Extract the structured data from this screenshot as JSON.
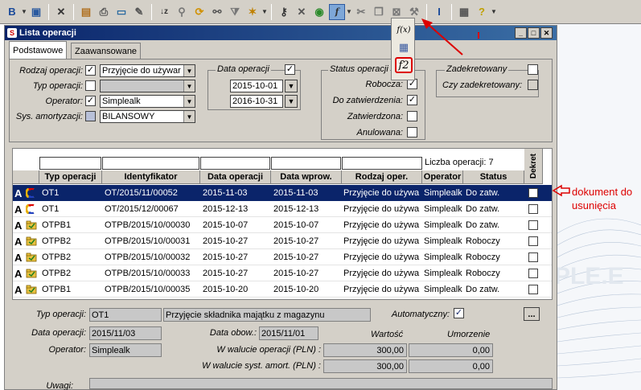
{
  "window": {
    "title": "Lista operacji",
    "tabs": [
      "Podstawowe",
      "Zaawansowane"
    ]
  },
  "toolbar": {
    "icons": [
      "bold-icon",
      "save-icon",
      "delete-icon",
      "document-icon",
      "print-icon",
      "export-icon",
      "edit-icon",
      "sort-icon",
      "pin-icon",
      "refresh-icon",
      "binoculars-icon",
      "filter-icon",
      "new-icon",
      "key-icon",
      "close-icon",
      "accept-icon",
      "function-icon",
      "cut-icon",
      "copy-icon",
      "cancel-icon",
      "tool-icon",
      "text-cursor-icon",
      "grid-icon",
      "help-icon"
    ]
  },
  "popup": {
    "items": [
      "f(x)",
      "grid",
      "f2"
    ]
  },
  "filters": {
    "rodzaj_label": "Rodzaj operacji:",
    "rodzaj_value": "Przyjęcie do używar",
    "typ_label": "Typ operacji:",
    "typ_value": "",
    "operator_label": "Operator:",
    "operator_value": "Simplealk",
    "sys_label": "Sys. amortyzacji:",
    "sys_value": "BILANSOWY",
    "data_group": "Data operacji",
    "date_from": "2015-10-01",
    "date_to": "2016-10-31",
    "status_group": "Status operacji",
    "robocza": "Robocza:",
    "do_zatwierdzenia": "Do zatwierdzenia:",
    "zatwierdzona": "Zatwierdzona:",
    "anulowana": "Anulowana:",
    "zadekretowany_group": "Zadekretowany",
    "czy_zadekretowany": "Czy zadekretowany:"
  },
  "grid": {
    "count_label": "Liczba operacji: 7",
    "columns": [
      "Typ operacji",
      "Identyfikator",
      "Data operacji",
      "Data wprow.",
      "Rodzaj oper.",
      "Operator",
      "Status",
      "Dekret"
    ],
    "rows": [
      {
        "typ": "OT1",
        "id": "OT/2015/11/00052",
        "data_op": "2015-11-03",
        "data_wpr": "2015-11-03",
        "rodzaj": "Przyjęcie do używa",
        "operator": "Simplealk",
        "status": "Do zatw."
      },
      {
        "typ": "OT1",
        "id": "OT/2015/12/00067",
        "data_op": "2015-12-13",
        "data_wpr": "2015-12-13",
        "rodzaj": "Przyjęcie do używa",
        "operator": "Simplealk",
        "status": "Do zatw."
      },
      {
        "typ": "OTPB1",
        "id": "OTPB/2015/10/00030",
        "data_op": "2015-10-07",
        "data_wpr": "2015-10-07",
        "rodzaj": "Przyjęcie do używa",
        "operator": "Simplealk",
        "status": "Do zatw."
      },
      {
        "typ": "OTPB2",
        "id": "OTPB/2015/10/00031",
        "data_op": "2015-10-27",
        "data_wpr": "2015-10-27",
        "rodzaj": "Przyjęcie do używa",
        "operator": "Simplealk",
        "status": "Roboczy"
      },
      {
        "typ": "OTPB2",
        "id": "OTPB/2015/10/00032",
        "data_op": "2015-10-27",
        "data_wpr": "2015-10-27",
        "rodzaj": "Przyjęcie do używa",
        "operator": "Simplealk",
        "status": "Roboczy"
      },
      {
        "typ": "OTPB2",
        "id": "OTPB/2015/10/00033",
        "data_op": "2015-10-27",
        "data_wpr": "2015-10-27",
        "rodzaj": "Przyjęcie do używa",
        "operator": "Simplealk",
        "status": "Roboczy"
      },
      {
        "typ": "OTPB1",
        "id": "OTPB/2015/10/00035",
        "data_op": "2015-10-20",
        "data_wpr": "2015-10-20",
        "rodzaj": "Przyjęcie do używa",
        "operator": "Simplealk",
        "status": "Do zatw."
      }
    ]
  },
  "details": {
    "typ_label": "Typ operacji:",
    "typ_value": "OT1",
    "typ_desc": "Przyjęcie składnika majątku z magazynu",
    "automatyczny_label": "Automatyczny:",
    "more_button": "...",
    "data_op_label": "Data operacji:",
    "data_op_value": "2015/11/03",
    "data_obow_label": "Data obow.:",
    "data_obow_value": "2015/11/01",
    "operator_label": "Operator:",
    "operator_value": "Simplealk",
    "wartosc_label": "Wartość",
    "umorzenie_label": "Umorzenie",
    "waluta_op_label": "W walucie operacji (PLN) :",
    "waluta_op_wartosc": "300,00",
    "waluta_op_umorzenie": "0,00",
    "waluta_sys_label": "W walucie syst. amort. (PLN) :",
    "waluta_sys_wartosc": "300,00",
    "waluta_sys_umorzenie": "0,00",
    "uwagi_label": "Uwagi:"
  },
  "annotation": {
    "line1": "dokument do",
    "line2": "usunięcia",
    "color": "#dd0000"
  },
  "watermark": "PLE.E"
}
